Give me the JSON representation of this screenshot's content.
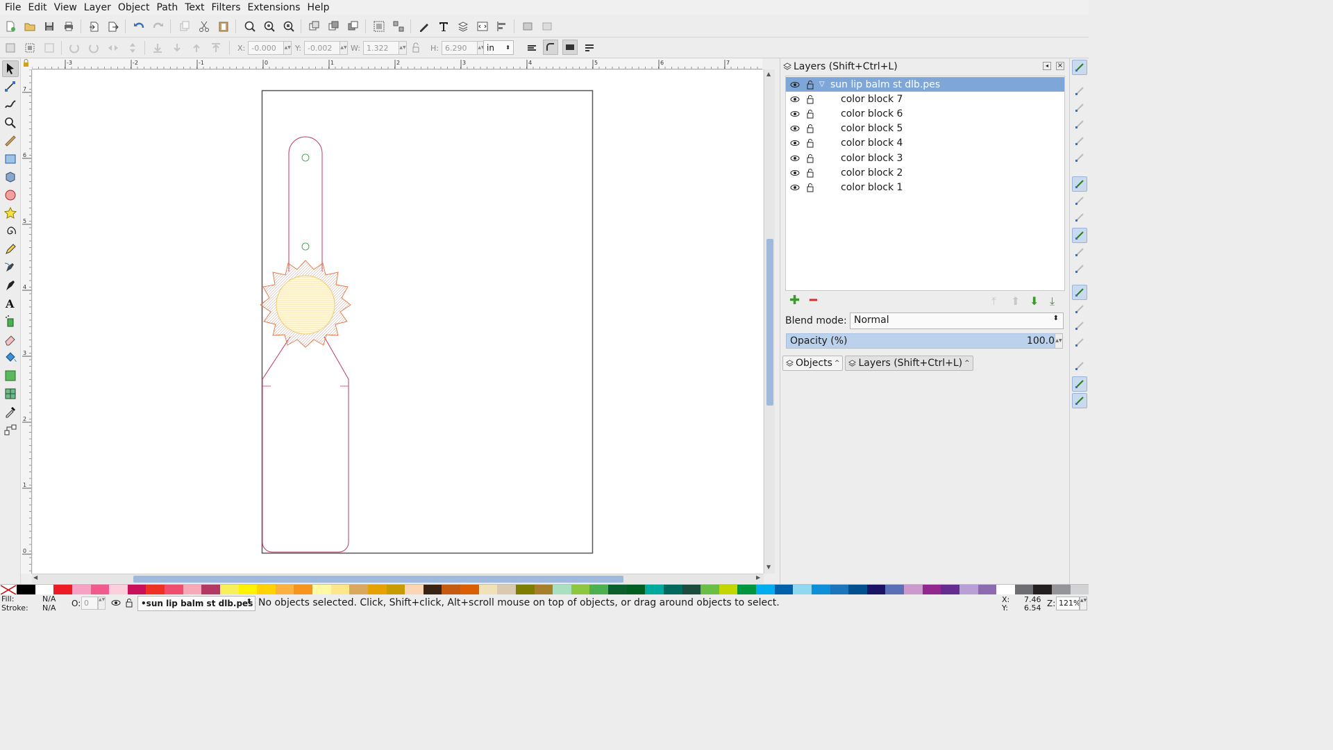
{
  "menu": [
    "File",
    "Edit",
    "View",
    "Layer",
    "Object",
    "Path",
    "Text",
    "Filters",
    "Extensions",
    "Help"
  ],
  "toolbar2": {
    "x_label": "X:",
    "x_value": "-0.000",
    "y_label": "Y:",
    "y_value": "-0.002",
    "w_label": "W:",
    "w_value": "1.322",
    "h_label": "H:",
    "h_value": "6.290",
    "unit": "in"
  },
  "ruler_top_labels": [
    "-3",
    "-2",
    "-1",
    "0",
    "1",
    "2",
    "3",
    "4",
    "5",
    "6",
    "7"
  ],
  "ruler_left_labels": [
    "7",
    "6",
    "5",
    "4",
    "3",
    "2",
    "1",
    "0"
  ],
  "layers_panel": {
    "title": "Layers (Shift+Ctrl+L)",
    "root": "sun lip balm st dlb.pes",
    "children": [
      "color block 7",
      "color block 6",
      "color block 5",
      "color block 4",
      "color block 3",
      "color block 2",
      "color block 1"
    ],
    "blend_label": "Blend mode:",
    "blend_value": "Normal",
    "opacity_label": "Opacity (%)",
    "opacity_value": "100.0",
    "tabs": [
      "Objects",
      "Layers (Shift+Ctrl+L)"
    ]
  },
  "palette": [
    "#000000",
    "#ffffff",
    "#ed1c24",
    "#f7a1c4",
    "#f05a8c",
    "#fbd0dc",
    "#c8105b",
    "#ee3125",
    "#f04e6e",
    "#f7a9b8",
    "#b23a62",
    "#f6f05a",
    "#fff200",
    "#ffd200",
    "#fbb040",
    "#f7941d",
    "#fff9a6",
    "#fde68c",
    "#d9a85c",
    "#e5a200",
    "#c89b00",
    "#fcd5b5",
    "#3b2314",
    "#c55a11",
    "#d95f02",
    "#f0e2b6",
    "#d9c9b0",
    "#7d7d00",
    "#a77f2a",
    "#a8e0c0",
    "#8dc63f",
    "#4cb050",
    "#0b5e2e",
    "#005e20",
    "#00a99d",
    "#00685c",
    "#1b4d3e",
    "#6abd45",
    "#c4d600",
    "#009640",
    "#00aeef",
    "#0060a9",
    "#8fd8f0",
    "#0e8fd7",
    "#1c75bc",
    "#00508f",
    "#1b1464",
    "#5b6fb6",
    "#cc99cc",
    "#92278f",
    "#662d91",
    "#b8a0d6",
    "#8c6bb1",
    "#ffffff",
    "#6d6e71",
    "#231f20",
    "#939598",
    "#d1d3d4"
  ],
  "status": {
    "fill_label": "Fill:",
    "fill_value": "N/A",
    "stroke_label": "Stroke:",
    "stroke_value": "N/A",
    "opacity_label": "O:",
    "opacity_value": "0",
    "layer": "•sun lip balm st dlb.pes",
    "message": "No objects selected. Click, Shift+click, Alt+scroll mouse on top of objects, or drag around objects to select.",
    "x_label": "X:",
    "x_value": "7.46",
    "y_label": "Y:",
    "y_value": "6.54",
    "zoom_label": "Z:",
    "zoom_value": "121%"
  }
}
